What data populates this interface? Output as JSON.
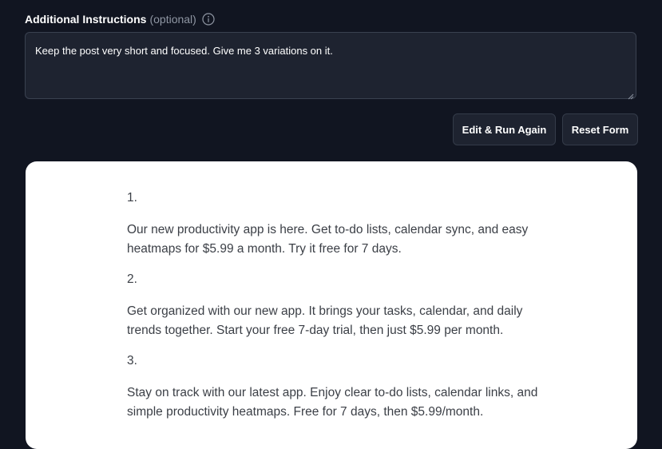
{
  "instructions": {
    "label": "Additional Instructions",
    "optional_label": "(optional)",
    "info_icon": "info-circle-icon",
    "value": "Keep the post very short and focused. Give me 3 variations on it."
  },
  "actions": {
    "edit_run_label": "Edit & Run Again",
    "reset_label": "Reset Form"
  },
  "result": {
    "items": [
      {
        "number": "1.",
        "text": "Our new productivity app is here. Get to-do lists, calendar sync, and easy heatmaps for $5.99 a month. Try it free for 7 days."
      },
      {
        "number": "2.",
        "text": "Get organized with our new app. It brings your tasks, calendar, and daily trends together. Start your free 7-day trial, then just $5.99 per month."
      },
      {
        "number": "3.",
        "text": "Stay on track with our latest app. Enjoy clear to-do lists, calendar links, and simple productivity heatmaps. Free for 7 days, then $5.99/month."
      }
    ]
  }
}
